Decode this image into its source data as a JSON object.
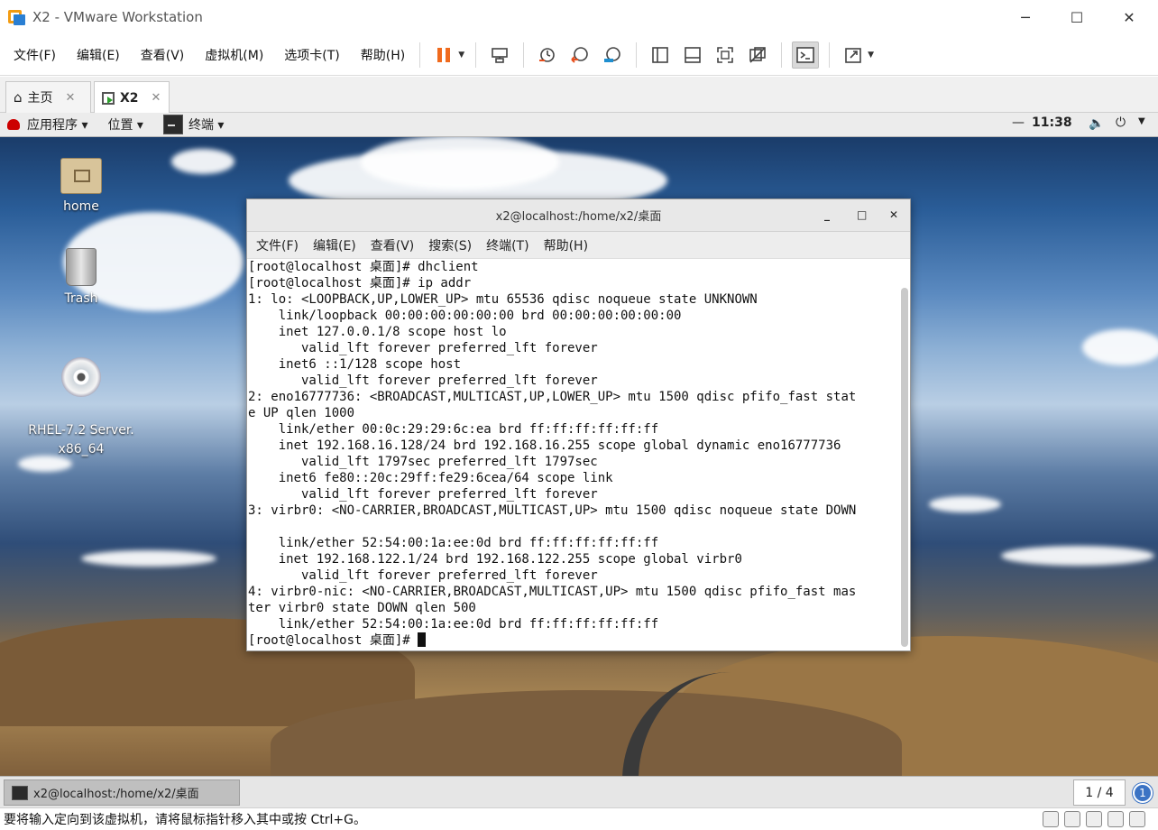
{
  "app": {
    "title": "X2 - VMware Workstation",
    "controls": {
      "minimize": "─",
      "maximize": "☐",
      "close": "✕"
    }
  },
  "menu": [
    "文件(F)",
    "编辑(E)",
    "查看(V)",
    "虚拟机(M)",
    "选项卡(T)",
    "帮助(H)"
  ],
  "toolbar": {
    "icons": [
      "pause-icon",
      "send-keys-icon",
      "snapshot-icon",
      "revert-snapshot-icon",
      "snapshot-manager-icon",
      "sidebar-icon",
      "thumbnail-icon",
      "fullscreen-icon",
      "unity-icon",
      "console-icon",
      "stretch-icon"
    ],
    "colors": {
      "pause": "#f06a1d",
      "snapshot_accent": "#e8501e"
    }
  },
  "tabs": [
    {
      "label": "主页",
      "close": "✕"
    },
    {
      "label": "X2",
      "close": "✕"
    }
  ],
  "guest": {
    "topbar": {
      "applications": "应用程序 ▾",
      "places": "位置 ▾",
      "terminal": "终端 ▾",
      "clock": "11:38"
    },
    "desktop_icons": [
      {
        "label": "home"
      },
      {
        "label": "Trash"
      },
      {
        "label": "RHEL-7.2 Server.\nx86_64"
      }
    ],
    "terminal": {
      "title": "x2@localhost:/home/x2/桌面",
      "menu": [
        "文件(F)",
        "编辑(E)",
        "查看(V)",
        "搜索(S)",
        "终端(T)",
        "帮助(H)"
      ],
      "lines": [
        "[root@localhost 桌面]# dhclient",
        "[root@localhost 桌面]# ip addr",
        "1: lo: <LOOPBACK,UP,LOWER_UP> mtu 65536 qdisc noqueue state UNKNOWN",
        "    link/loopback 00:00:00:00:00:00 brd 00:00:00:00:00:00",
        "    inet 127.0.0.1/8 scope host lo",
        "       valid_lft forever preferred_lft forever",
        "    inet6 ::1/128 scope host",
        "       valid_lft forever preferred_lft forever",
        "2: eno16777736: <BROADCAST,MULTICAST,UP,LOWER_UP> mtu 1500 qdisc pfifo_fast stat",
        "e UP qlen 1000",
        "    link/ether 00:0c:29:29:6c:ea brd ff:ff:ff:ff:ff:ff",
        "    inet 192.168.16.128/24 brd 192.168.16.255 scope global dynamic eno16777736",
        "       valid_lft 1797sec preferred_lft 1797sec",
        "    inet6 fe80::20c:29ff:fe29:6cea/64 scope link",
        "       valid_lft forever preferred_lft forever",
        "3: virbr0: <NO-CARRIER,BROADCAST,MULTICAST,UP> mtu 1500 qdisc noqueue state DOWN",
        "",
        "    link/ether 52:54:00:1a:ee:0d brd ff:ff:ff:ff:ff:ff",
        "    inet 192.168.122.1/24 brd 192.168.122.255 scope global virbr0",
        "       valid_lft forever preferred_lft forever",
        "4: virbr0-nic: <NO-CARRIER,BROADCAST,MULTICAST,UP> mtu 1500 qdisc pfifo_fast mas",
        "ter virbr0 state DOWN qlen 500",
        "    link/ether 52:54:00:1a:ee:0d brd ff:ff:ff:ff:ff:ff"
      ],
      "prompt": "[root@localhost 桌面]# "
    },
    "taskbar": {
      "window_label": "x2@localhost:/home/x2/桌面",
      "workspace": "1 / 4",
      "notifications": "1"
    }
  },
  "statusbar": {
    "message": "要将输入定向到该虚拟机，请将鼠标指针移入其中或按 Ctrl+G。"
  }
}
